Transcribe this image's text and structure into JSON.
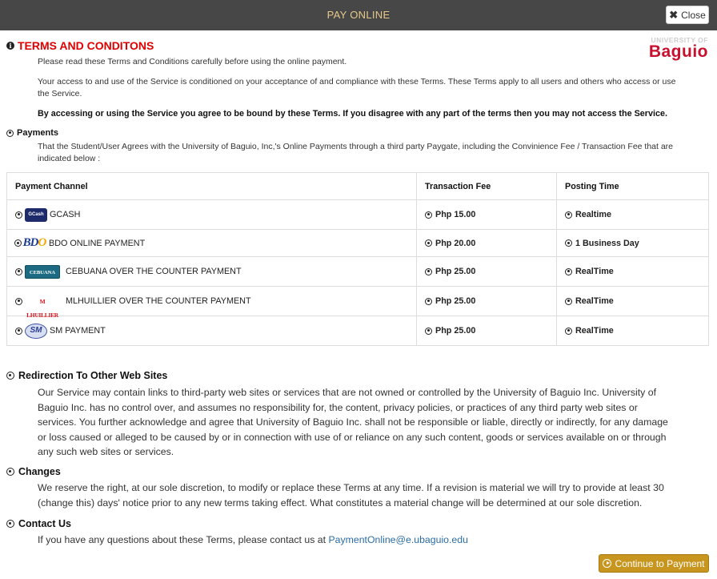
{
  "header": {
    "title": "PAY ONLINE",
    "close_label": "Close"
  },
  "logo": {
    "top": "UNIVERSITY OF",
    "main": "Baguio"
  },
  "terms": {
    "title": "TERMS AND CONDITONS",
    "p1": "Please read these Terms and Conditions carefully before using the online payment.",
    "p2_line1": "Your access to and use of the Service is conditioned on your acceptance of and compliance with these Terms. These Terms apply to all users and others who access or use",
    "p2_line2": "the Service.",
    "p3": "By accessing or using the Service you agree to be bound by these Terms. If you disagree with any part of the terms then you may not access the Service."
  },
  "payments": {
    "heading": "Payments",
    "desc_line1": "That the Student/User Agrees with the University of Baguio, Inc,'s Online Payments through a third party Paygate, including the Convinience Fee / Transaction Fee that are",
    "desc_line2": "indicated below :",
    "columns": [
      "Payment Channel",
      "Transaction Fee",
      "Posting Time"
    ],
    "rows": [
      {
        "logo": "GCash",
        "channel": "GCASH",
        "fee": "Php 15.00",
        "posting": "Realtime"
      },
      {
        "logo": "BDO",
        "channel": "BDO ONLINE PAYMENT",
        "fee": "Php 20.00",
        "posting": "1 Business Day"
      },
      {
        "logo": "CEBUANA",
        "channel": "CEBUANA OVER THE COUNTER PAYMENT",
        "fee": "Php 25.00",
        "posting": "RealTime"
      },
      {
        "logo": "M LHUILLIER",
        "channel": "MLHUILLIER OVER THE COUNTER PAYMENT",
        "fee": "Php 25.00",
        "posting": "RealTime"
      },
      {
        "logo": "SM",
        "channel": "SM PAYMENT",
        "fee": "Php 25.00",
        "posting": "RealTime"
      }
    ]
  },
  "redirection": {
    "heading": "Redirection To Other Web Sites",
    "lines": [
      "Our Service may contain links to third-party web sites or services that are not owned or controlled by the University of Baguio Inc. University of",
      "Baguio Inc. has no control over, and assumes no responsibility for, the content, privacy policies, or practices of any third party web sites or",
      "services. You further acknowledge and agree that University of Baguio Inc. shall not be responsible or liable, directly or indirectly, for any damage",
      "or loss caused or alleged to be caused by or in connection with use of or reliance on any such content, goods or services available on or through",
      "any such web sites or services."
    ]
  },
  "changes": {
    "heading": "Changes",
    "lines": [
      "We reserve the right, at our sole discretion, to modify or replace these Terms at any time. If a revision is material we will try to provide at least 30",
      "(change this) days' notice prior to any new terms taking effect. What constitutes a material change will be determined at our sole discretion."
    ]
  },
  "contact": {
    "heading": "Contact Us",
    "text": "If you have any questions about these Terms, please contact us at ",
    "email": "PaymentOnline@e.ubaguio.edu"
  },
  "footer": {
    "continue_label": "Continue to Payment"
  }
}
